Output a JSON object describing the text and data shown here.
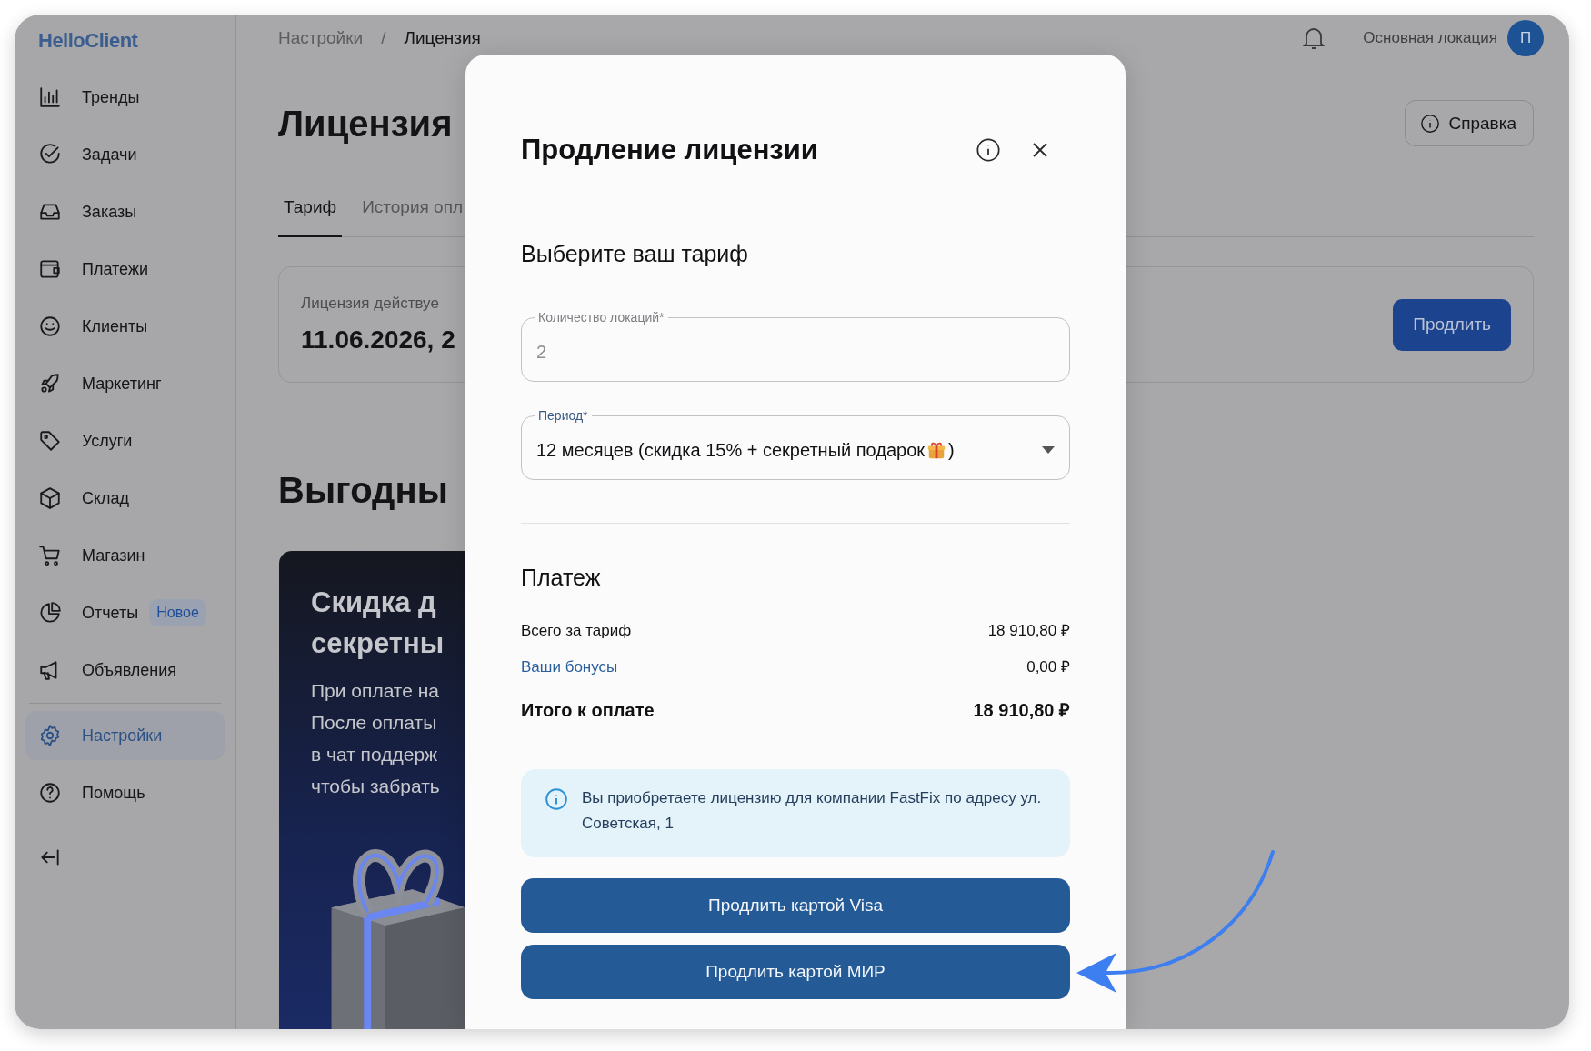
{
  "app": {
    "logo": "HelloClient"
  },
  "sidebar": {
    "groups": [
      {
        "items": [
          {
            "label": "Тренды",
            "selected": false
          },
          {
            "label": "Задачи",
            "selected": false
          },
          {
            "label": "Заказы",
            "selected": false
          },
          {
            "label": "Платежи",
            "selected": false
          },
          {
            "label": "Клиенты",
            "selected": false
          },
          {
            "label": "Маркетинг",
            "selected": false
          },
          {
            "label": "Услуги",
            "selected": false
          },
          {
            "label": "Склад",
            "selected": false
          },
          {
            "label": "Магазин",
            "selected": false
          },
          {
            "label": "Отчеты",
            "selected": false,
            "badge": "Новое"
          },
          {
            "label": "Объявления",
            "selected": false
          }
        ]
      },
      {
        "items": [
          {
            "label": "Настройки",
            "selected": true
          },
          {
            "label": "Помощь",
            "selected": false
          }
        ]
      }
    ]
  },
  "header": {
    "breadcrumb": [
      "Настройки",
      "Лицензия"
    ],
    "breadcrumb_separator": "/",
    "location": "Основная локация",
    "avatar": "П"
  },
  "page": {
    "title": "Лицензия",
    "help_button": "Справка",
    "tabs": [
      {
        "label": "Тариф",
        "selected": true
      },
      {
        "label": "История опл",
        "selected": false
      }
    ],
    "license_card": {
      "label": "Лицензия действуе",
      "value": "11.06.2026, 2",
      "button": "Продлить"
    },
    "offers": {
      "title": "Выгодны",
      "promo": {
        "title_lines": [
          "Скидка д",
          "секретны"
        ],
        "lines": [
          "При оплате на",
          "После оплаты",
          "в чат поддерж",
          "чтобы забрать"
        ]
      }
    }
  },
  "modal": {
    "title": "Продление лицензии",
    "subtitle": "Выберите ваш тариф",
    "fields": [
      {
        "kind": "input",
        "label": "Количество локаций*",
        "value": "2",
        "disabled": true
      },
      {
        "kind": "select",
        "label": "Период*",
        "value": "12 месяцев (скидка 15% + секретный подарок",
        "value_end": ")",
        "disabled": false
      }
    ],
    "payment": {
      "title": "Платеж",
      "rows": [
        {
          "kind": "plain",
          "label": "Всего за тариф",
          "amount": "18 910,80 ₽"
        },
        {
          "kind": "link",
          "label": "Ваши бонусы",
          "amount": "0,00 ₽"
        },
        {
          "kind": "total",
          "label": "Итого к оплате",
          "amount": "18 910,80 ₽"
        }
      ]
    },
    "notice": "Вы приобретаете лицензию для компании FastFix по адресу ул. Советская, 1",
    "buttons": [
      "Продлить картой Visa",
      "Продлить картой МИР"
    ]
  }
}
